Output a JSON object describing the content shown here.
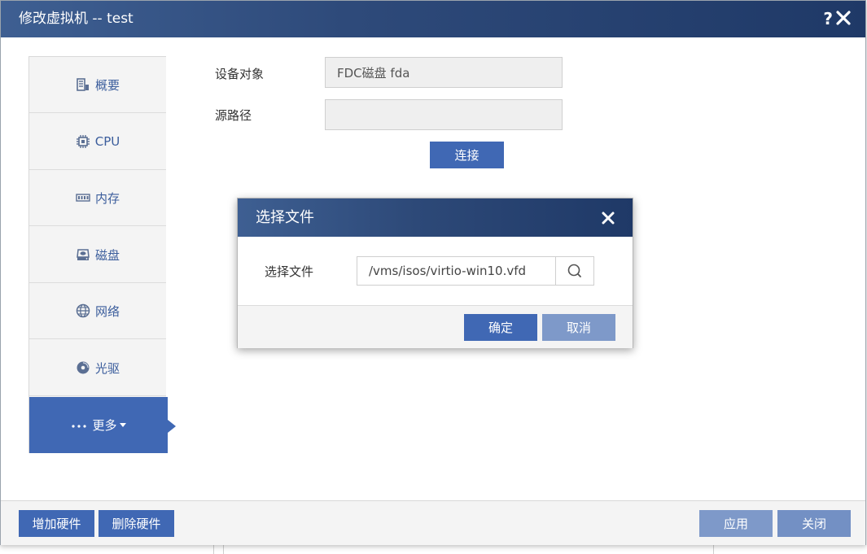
{
  "window": {
    "title": "修改虚拟机 -- test",
    "help_label": "?"
  },
  "sidebar": {
    "items": [
      {
        "label": "概要",
        "icon": "summary-icon"
      },
      {
        "label": "CPU",
        "icon": "cpu-icon"
      },
      {
        "label": "内存",
        "icon": "memory-icon"
      },
      {
        "label": "磁盘",
        "icon": "disk-icon"
      },
      {
        "label": "网络",
        "icon": "globe-icon"
      },
      {
        "label": "光驱",
        "icon": "cdrom-icon"
      },
      {
        "label": "更多",
        "icon": "more-dots-icon",
        "active": true
      }
    ]
  },
  "form": {
    "device_label": "设备对象",
    "device_value": "FDC磁盘 fda",
    "source_label": "源路径",
    "source_value": "",
    "connect_label": "连接"
  },
  "modal": {
    "title": "选择文件",
    "field_label": "选择文件",
    "file_value": "/vms/isos/virtio-win10.vfd",
    "ok_label": "确定",
    "cancel_label": "取消"
  },
  "bottombar": {
    "add_label": "增加硬件",
    "remove_label": "删除硬件",
    "apply_label": "应用",
    "close_label": "关闭"
  },
  "colors": {
    "accent": "#4068b4",
    "accent_light": "#7e99c9",
    "titlebar": "#2e4a7a"
  }
}
